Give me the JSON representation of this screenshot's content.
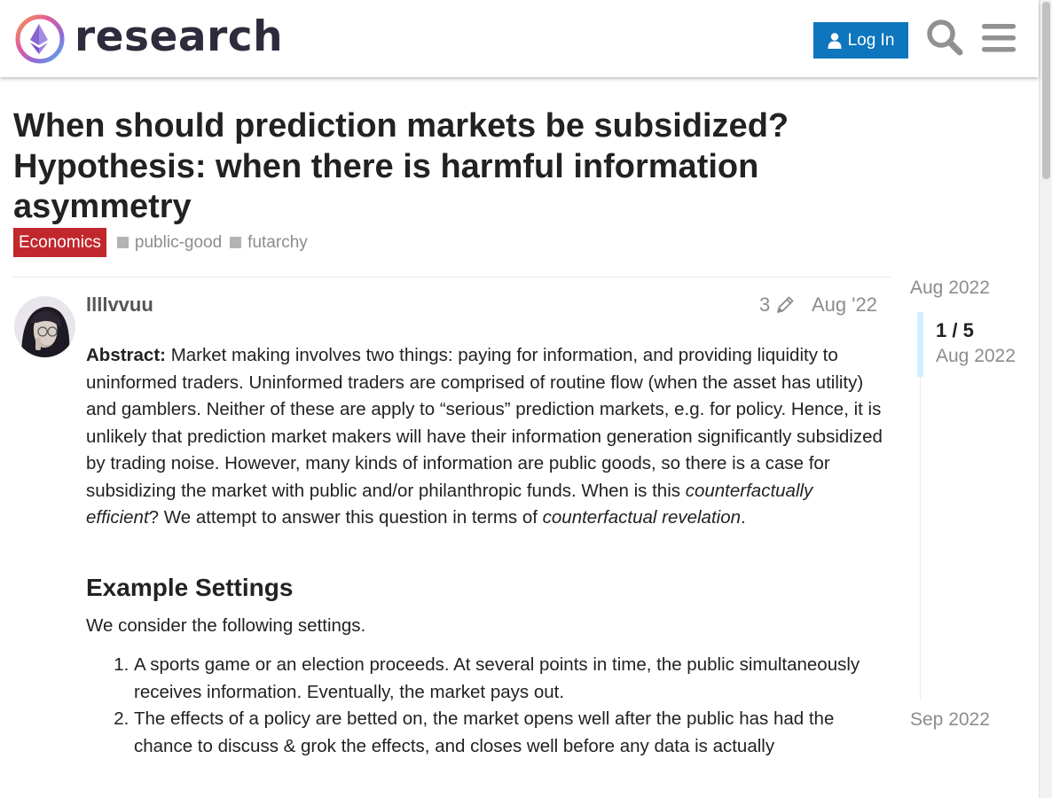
{
  "header": {
    "site_name": "research",
    "login_label": "Log In",
    "logo_icon": "ethereum-research-logo",
    "search_icon": "search-icon",
    "menu_icon": "hamburger-menu-icon",
    "login_color": "#0e76bd"
  },
  "topic": {
    "title": "When should prediction markets be subsidized? Hypothesis: when there is harmful information asymmetry",
    "category": "Economics",
    "category_color": "#c1272d",
    "tags": [
      "public-good",
      "futarchy"
    ]
  },
  "post": {
    "username": "llllvvuu",
    "edit_count": "3",
    "date": "Aug '22",
    "abstract_label": "Abstract:",
    "abstract_text": " Market making involves two things: paying for information, and providing liquidity to uninformed traders. Uninformed traders are comprised of routine flow (when the asset has utility) and gamblers. Neither of these are apply to “serious” prediction markets, e.g. for policy. Hence, it is unlikely that prediction market makers will have their information generation significantly subsidized by trading noise. However, many kinds of information are public goods, so there is a case for subsidizing the market with public and/or philanthropic funds. When is this ",
    "abstract_em1": "counterfactually efficient",
    "abstract_mid": "? We attempt to answer this question in terms of ",
    "abstract_em2": "counterfactual revelation",
    "abstract_end": ".",
    "section_heading": "Example Settings",
    "section_intro": "We consider the following settings.",
    "list_items": [
      "A sports game or an election proceeds. At several points in time, the public simultaneously receives information. Eventually, the market pays out.",
      "The effects of a policy are betted on, the market opens well after the public has had the chance to discuss & grok the effects, and closes well before any data is actually"
    ]
  },
  "timeline": {
    "start": "Aug 2022",
    "position": "1 / 5",
    "current_date": "Aug 2022",
    "end": "Sep 2022"
  }
}
